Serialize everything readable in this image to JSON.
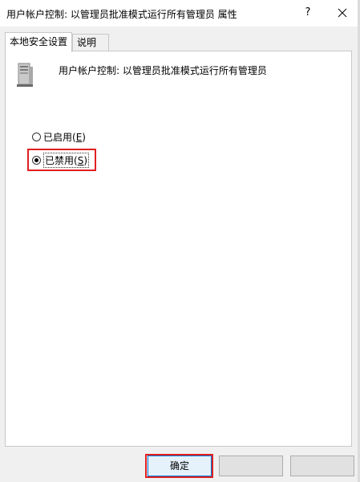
{
  "window": {
    "title": "用户帐户控制: 以管理员批准模式运行所有管理员 属性",
    "help_label": "?"
  },
  "tabs": [
    {
      "label": "本地安全设置",
      "active": true
    },
    {
      "label": "说明",
      "active": false
    }
  ],
  "policy": {
    "name": "用户帐户控制: 以管理员批准模式运行所有管理员"
  },
  "options": {
    "enabled": {
      "label": "已启用",
      "hotkey": "E",
      "checked": false
    },
    "disabled": {
      "label": "已禁用",
      "hotkey": "S",
      "checked": true
    }
  },
  "buttons": {
    "ok_label": "确定",
    "cancel_label": "",
    "apply_label": ""
  },
  "colors": {
    "highlight": "#e02020",
    "ok_border": "#0078d7"
  }
}
